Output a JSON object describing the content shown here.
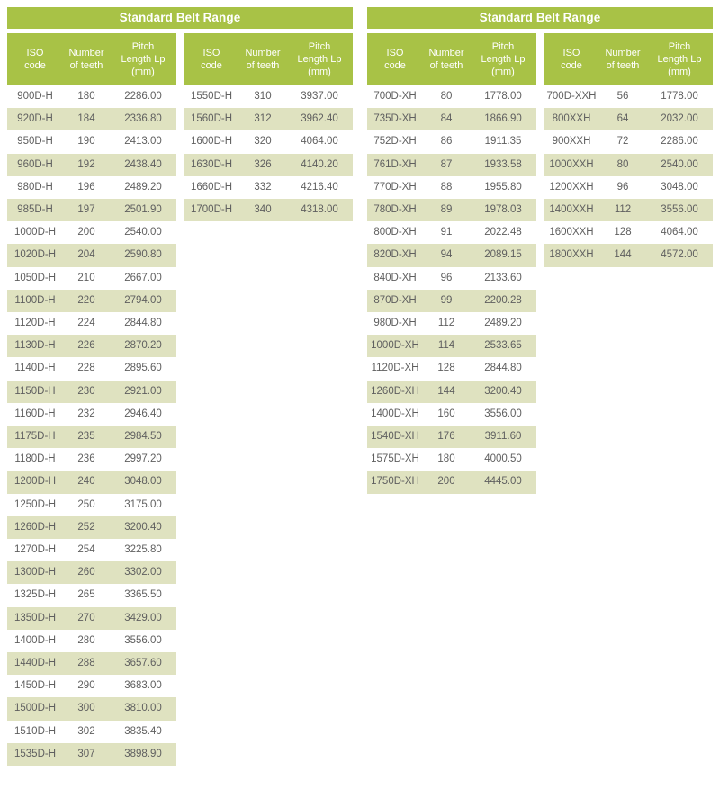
{
  "page": {
    "background_color": "#ffffff",
    "text_color": "#5f5f5f",
    "accent_color": "#a8c246",
    "stripe_color": "#dfe2c0"
  },
  "columns": {
    "iso_line1": "ISO",
    "iso_line2": "code",
    "teeth_line1": "Number",
    "teeth_line2": "of teeth",
    "pitch_line1": "Pitch",
    "pitch_line2": "Length Lp",
    "pitch_line3": "(mm)"
  },
  "groups": [
    {
      "title": "Standard Belt Range",
      "subtables": [
        {
          "rows": [
            {
              "iso": "900D-H",
              "teeth": "180",
              "pitch": "2286.00"
            },
            {
              "iso": "920D-H",
              "teeth": "184",
              "pitch": "2336.80"
            },
            {
              "iso": "950D-H",
              "teeth": "190",
              "pitch": "2413.00"
            },
            {
              "iso": "960D-H",
              "teeth": "192",
              "pitch": "2438.40"
            },
            {
              "iso": "980D-H",
              "teeth": "196",
              "pitch": "2489.20"
            },
            {
              "iso": "985D-H",
              "teeth": "197",
              "pitch": "2501.90"
            },
            {
              "iso": "1000D-H",
              "teeth": "200",
              "pitch": "2540.00"
            },
            {
              "iso": "1020D-H",
              "teeth": "204",
              "pitch": "2590.80"
            },
            {
              "iso": "1050D-H",
              "teeth": "210",
              "pitch": "2667.00"
            },
            {
              "iso": "1100D-H",
              "teeth": "220",
              "pitch": "2794.00"
            },
            {
              "iso": "1120D-H",
              "teeth": "224",
              "pitch": "2844.80"
            },
            {
              "iso": "1130D-H",
              "teeth": "226",
              "pitch": "2870.20"
            },
            {
              "iso": "1140D-H",
              "teeth": "228",
              "pitch": "2895.60"
            },
            {
              "iso": "1150D-H",
              "teeth": "230",
              "pitch": "2921.00"
            },
            {
              "iso": "1160D-H",
              "teeth": "232",
              "pitch": "2946.40"
            },
            {
              "iso": "1175D-H",
              "teeth": "235",
              "pitch": "2984.50"
            },
            {
              "iso": "1180D-H",
              "teeth": "236",
              "pitch": "2997.20"
            },
            {
              "iso": "1200D-H",
              "teeth": "240",
              "pitch": "3048.00"
            },
            {
              "iso": "1250D-H",
              "teeth": "250",
              "pitch": "3175.00"
            },
            {
              "iso": "1260D-H",
              "teeth": "252",
              "pitch": "3200.40"
            },
            {
              "iso": "1270D-H",
              "teeth": "254",
              "pitch": "3225.80"
            },
            {
              "iso": "1300D-H",
              "teeth": "260",
              "pitch": "3302.00"
            },
            {
              "iso": "1325D-H",
              "teeth": "265",
              "pitch": "3365.50"
            },
            {
              "iso": "1350D-H",
              "teeth": "270",
              "pitch": "3429.00"
            },
            {
              "iso": "1400D-H",
              "teeth": "280",
              "pitch": "3556.00"
            },
            {
              "iso": "1440D-H",
              "teeth": "288",
              "pitch": "3657.60"
            },
            {
              "iso": "1450D-H",
              "teeth": "290",
              "pitch": "3683.00"
            },
            {
              "iso": "1500D-H",
              "teeth": "300",
              "pitch": "3810.00"
            },
            {
              "iso": "1510D-H",
              "teeth": "302",
              "pitch": "3835.40"
            },
            {
              "iso": "1535D-H",
              "teeth": "307",
              "pitch": "3898.90"
            }
          ]
        },
        {
          "rows": [
            {
              "iso": "1550D-H",
              "teeth": "310",
              "pitch": "3937.00"
            },
            {
              "iso": "1560D-H",
              "teeth": "312",
              "pitch": "3962.40"
            },
            {
              "iso": "1600D-H",
              "teeth": "320",
              "pitch": "4064.00"
            },
            {
              "iso": "1630D-H",
              "teeth": "326",
              "pitch": "4140.20"
            },
            {
              "iso": "1660D-H",
              "teeth": "332",
              "pitch": "4216.40"
            },
            {
              "iso": "1700D-H",
              "teeth": "340",
              "pitch": "4318.00"
            }
          ]
        }
      ]
    },
    {
      "title": "Standard Belt Range",
      "subtables": [
        {
          "rows": [
            {
              "iso": "700D-XH",
              "teeth": "80",
              "pitch": "1778.00"
            },
            {
              "iso": "735D-XH",
              "teeth": "84",
              "pitch": "1866.90"
            },
            {
              "iso": "752D-XH",
              "teeth": "86",
              "pitch": "1911.35"
            },
            {
              "iso": "761D-XH",
              "teeth": "87",
              "pitch": "1933.58"
            },
            {
              "iso": "770D-XH",
              "teeth": "88",
              "pitch": "1955.80"
            },
            {
              "iso": "780D-XH",
              "teeth": "89",
              "pitch": "1978.03"
            },
            {
              "iso": "800D-XH",
              "teeth": "91",
              "pitch": "2022.48"
            },
            {
              "iso": "820D-XH",
              "teeth": "94",
              "pitch": "2089.15"
            },
            {
              "iso": "840D-XH",
              "teeth": "96",
              "pitch": "2133.60"
            },
            {
              "iso": "870D-XH",
              "teeth": "99",
              "pitch": "2200.28"
            },
            {
              "iso": "980D-XH",
              "teeth": "112",
              "pitch": "2489.20"
            },
            {
              "iso": "1000D-XH",
              "teeth": "114",
              "pitch": "2533.65"
            },
            {
              "iso": "1120D-XH",
              "teeth": "128",
              "pitch": "2844.80"
            },
            {
              "iso": "1260D-XH",
              "teeth": "144",
              "pitch": "3200.40"
            },
            {
              "iso": "1400D-XH",
              "teeth": "160",
              "pitch": "3556.00"
            },
            {
              "iso": "1540D-XH",
              "teeth": "176",
              "pitch": "3911.60"
            },
            {
              "iso": "1575D-XH",
              "teeth": "180",
              "pitch": "4000.50"
            },
            {
              "iso": "1750D-XH",
              "teeth": "200",
              "pitch": "4445.00"
            }
          ]
        },
        {
          "rows": [
            {
              "iso": "700D-XXH",
              "teeth": "56",
              "pitch": "1778.00"
            },
            {
              "iso": "800XXH",
              "teeth": "64",
              "pitch": "2032.00"
            },
            {
              "iso": "900XXH",
              "teeth": "72",
              "pitch": "2286.00"
            },
            {
              "iso": "1000XXH",
              "teeth": "80",
              "pitch": "2540.00"
            },
            {
              "iso": "1200XXH",
              "teeth": "96",
              "pitch": "3048.00"
            },
            {
              "iso": "1400XXH",
              "teeth": "112",
              "pitch": "3556.00"
            },
            {
              "iso": "1600XXH",
              "teeth": "128",
              "pitch": "4064.00"
            },
            {
              "iso": "1800XXH",
              "teeth": "144",
              "pitch": "4572.00"
            }
          ]
        }
      ]
    }
  ]
}
